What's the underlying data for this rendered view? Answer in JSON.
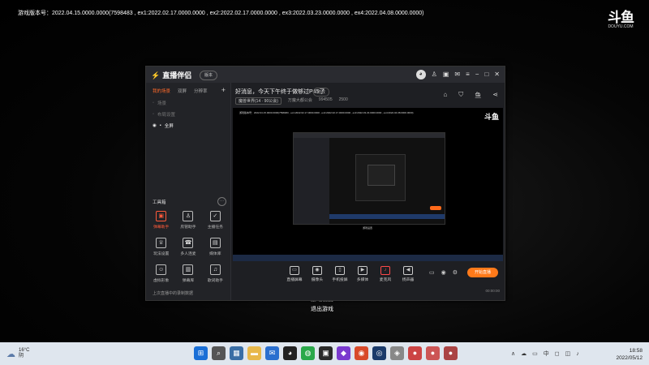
{
  "game": {
    "version_line": "游戏版本号：2022.04.15.0000.0000(7598483 , ex1:2022.02.17.0000.0000 , ex2:2022.02.17.0000.0000 , ex3:2022.03.23.0000.0000 , ex4:2022.04.08.0000.0000)",
    "watermark_sub": "DOUYU.COM",
    "menu": [
      "游戏设置",
      "退出游戏"
    ]
  },
  "app": {
    "name": "直播伴侣",
    "version_button": "版本",
    "sidebar": {
      "tabs": [
        "我的场景",
        "双屏",
        "分辨率"
      ],
      "scenes": [
        {
          "label": "场景",
          "active": false
        },
        {
          "label": "布局设置",
          "active": false
        },
        {
          "label": "全屏",
          "active": true
        }
      ],
      "tools_title": "工具箱",
      "tools": [
        {
          "label": "弹幕助手",
          "icon": "▣",
          "hot": true
        },
        {
          "label": "房管助手",
          "icon": "♙",
          "hot": false
        },
        {
          "label": "主播任务",
          "icon": "✓",
          "hot": false
        },
        {
          "label": "玩法设置",
          "icon": "♕",
          "hot": false
        },
        {
          "label": "多人连麦",
          "icon": "☎",
          "hot": false
        },
        {
          "label": "媒体库",
          "icon": "▤",
          "hot": false
        },
        {
          "label": "虚拟形象",
          "icon": "☺",
          "hot": false
        },
        {
          "label": "弹幕库",
          "icon": "▥",
          "hot": false
        },
        {
          "label": "歌词助手",
          "icon": "♫",
          "hot": false
        }
      ],
      "footer": "上次直播中的录制数据"
    },
    "room": {
      "title": "好消息，今天下午终于做够过P45了",
      "edit": "修改",
      "category": "魔兽世界(14 · 90公会)",
      "meta1": "万魔大都公会",
      "meta2": "994505",
      "meta3": "2500"
    },
    "preview": {
      "watermark": "斗鱼"
    },
    "controls": [
      {
        "label": "直播屏幕",
        "icon": "▭",
        "red": false
      },
      {
        "label": "摄像头",
        "icon": "◉",
        "red": false
      },
      {
        "label": "手机投屏",
        "icon": "▯",
        "red": false
      },
      {
        "label": "多媒体",
        "icon": "▶",
        "red": false
      },
      {
        "label": "麦克风",
        "icon": "♪",
        "red": true
      },
      {
        "label": "扬声器",
        "icon": "◀",
        "red": false
      }
    ],
    "start_button": "开始直播",
    "status_left": "",
    "status_right": "00:00:00"
  },
  "taskbar": {
    "weather_temp": "16°C",
    "weather_desc": "阴",
    "apps": [
      {
        "icon": "⊞",
        "color": "#1a6fd6"
      },
      {
        "icon": "⌕",
        "color": "#555"
      },
      {
        "icon": "▦",
        "color": "#3a6ea5"
      },
      {
        "icon": "▬",
        "color": "#e8b84a"
      },
      {
        "icon": "✉",
        "color": "#2a6fcf"
      },
      {
        "icon": "◕",
        "color": "#222"
      },
      {
        "icon": "◍",
        "color": "#2aa84a"
      },
      {
        "icon": "▣",
        "color": "#2a2a2a"
      },
      {
        "icon": "◆",
        "color": "#7a3acf"
      },
      {
        "icon": "◉",
        "color": "#d84a2a"
      },
      {
        "icon": "◎",
        "color": "#1a3a6a"
      },
      {
        "icon": "◈",
        "color": "#888"
      },
      {
        "icon": "●",
        "color": "#c44"
      },
      {
        "icon": "●",
        "color": "#c55"
      },
      {
        "icon": "●",
        "color": "#a44"
      }
    ],
    "tray": [
      "∧",
      "☁",
      "▭",
      "中",
      "◻",
      "◫",
      "♪"
    ],
    "time": "18:58",
    "date": "2022/05/12"
  }
}
